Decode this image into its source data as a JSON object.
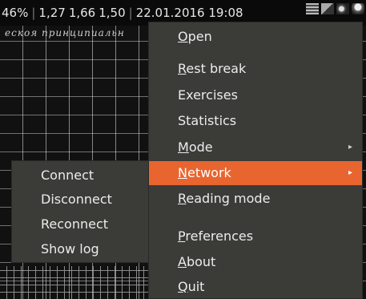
{
  "statusbar": {
    "battery": "46%",
    "load1": "1,27",
    "load5": "1,66",
    "load15": "1,50",
    "datetime": "22.01.2016 19:08"
  },
  "background": {
    "handwriting": "ескоя    принципиальн"
  },
  "tray_icons": [
    "keyboard-layout-icon",
    "network-icon",
    "volume-icon",
    "user-avatar-icon"
  ],
  "menu": {
    "items": [
      {
        "pre": "",
        "u": "O",
        "rest": "pen"
      },
      {
        "pre": "",
        "u": "R",
        "rest": "est break"
      },
      {
        "pre": "",
        "u": "",
        "rest": "Exercises"
      },
      {
        "pre": "",
        "u": "",
        "rest": "Statistics"
      },
      {
        "pre": "",
        "u": "M",
        "rest": "ode"
      },
      {
        "pre": "",
        "u": "N",
        "rest": "etwork"
      },
      {
        "pre": "",
        "u": "R",
        "rest": "eading mode"
      },
      {
        "pre": "",
        "u": "P",
        "rest": "references"
      },
      {
        "pre": "",
        "u": "A",
        "rest": "bout"
      },
      {
        "pre": "",
        "u": "Q",
        "rest": "uit"
      }
    ],
    "submenu_arrow": "▸",
    "active_color": "#e8652f"
  },
  "submenu": {
    "items": [
      "Connect",
      "Disconnect",
      "Reconnect",
      "Show log"
    ]
  }
}
